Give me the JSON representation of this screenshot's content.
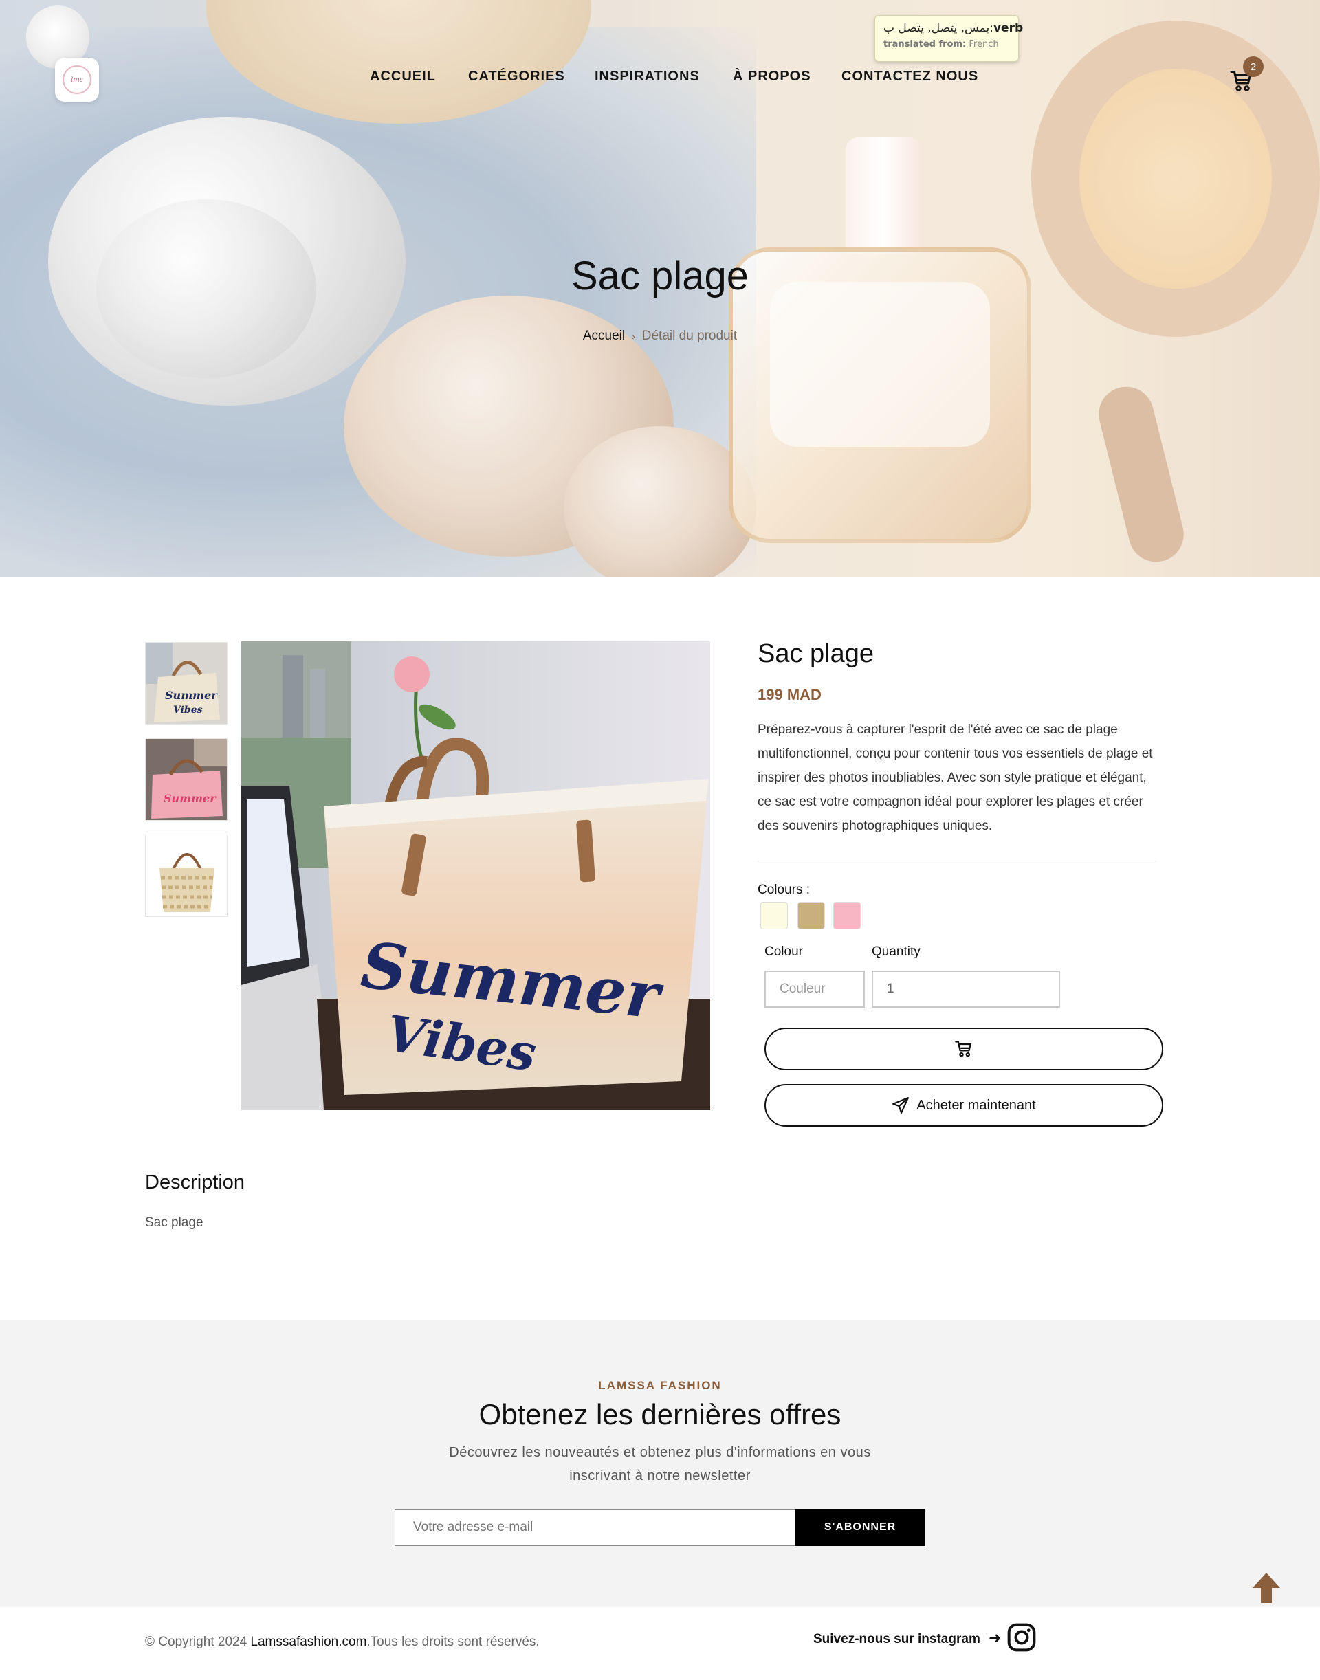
{
  "translation_tooltip": {
    "arabic": "يمس, يتصل, يتصل ب",
    "pos": "verb",
    "from_label": "translated from:",
    "from_lang": "French"
  },
  "header": {
    "nav": [
      "ACCUEIL",
      "CATÉGORIES",
      "INSPIRATIONS",
      "À PROPOS",
      "CONTACTEZ NOUS"
    ],
    "cart_count": "2"
  },
  "hero": {
    "title": "Sac plage",
    "breadcrumb_home": "Accueil",
    "breadcrumb_separator": "›",
    "breadcrumb_current": "Détail du produit"
  },
  "product": {
    "title": "Sac plage",
    "price": "199 MAD",
    "description": "Préparez-vous à capturer l'esprit de l'été avec ce sac de plage multifonctionnel, conçu pour contenir tous vos essentiels de plage et inspirer des photos inoubliables. Avec son style pratique et élégant, ce sac est votre compagnon idéal pour explorer les plages et créer des souvenirs photographiques uniques.",
    "colours_label": "Colours :",
    "swatches": [
      "#fdfbe2",
      "#c9ae7e",
      "#f8b6c5"
    ],
    "colour_field_label": "Colour",
    "colour_placeholder": "Couleur",
    "quantity_label": "Quantity",
    "quantity_value": "1",
    "buy_now_label": "Acheter maintenant",
    "image_text_1": "Summer",
    "image_text_2": "Vibes"
  },
  "description_section": {
    "title": "Description",
    "body": "Sac plage"
  },
  "newsletter": {
    "kicker": "LAMSSA FASHION",
    "title": "Obtenez les dernières offres",
    "text": "Découvrez les nouveautés et obtenez plus d'informations en vous inscrivant à notre newsletter",
    "email_placeholder": "Votre adresse e-mail",
    "subscribe_label": "S'ABONNER"
  },
  "footer": {
    "copyright_prefix": "© Copyright 2024 ",
    "site_name": "Lamssafashion.com",
    "copyright_suffix": ".Tous les droits sont réservés.",
    "instagram_text": "Suivez-nous sur instagram",
    "instagram_arrow": "➜"
  },
  "colors": {
    "accent_brown": "#8b5e3c",
    "newsletter_bg": "#f3f3f3",
    "button_black": "#000000"
  }
}
